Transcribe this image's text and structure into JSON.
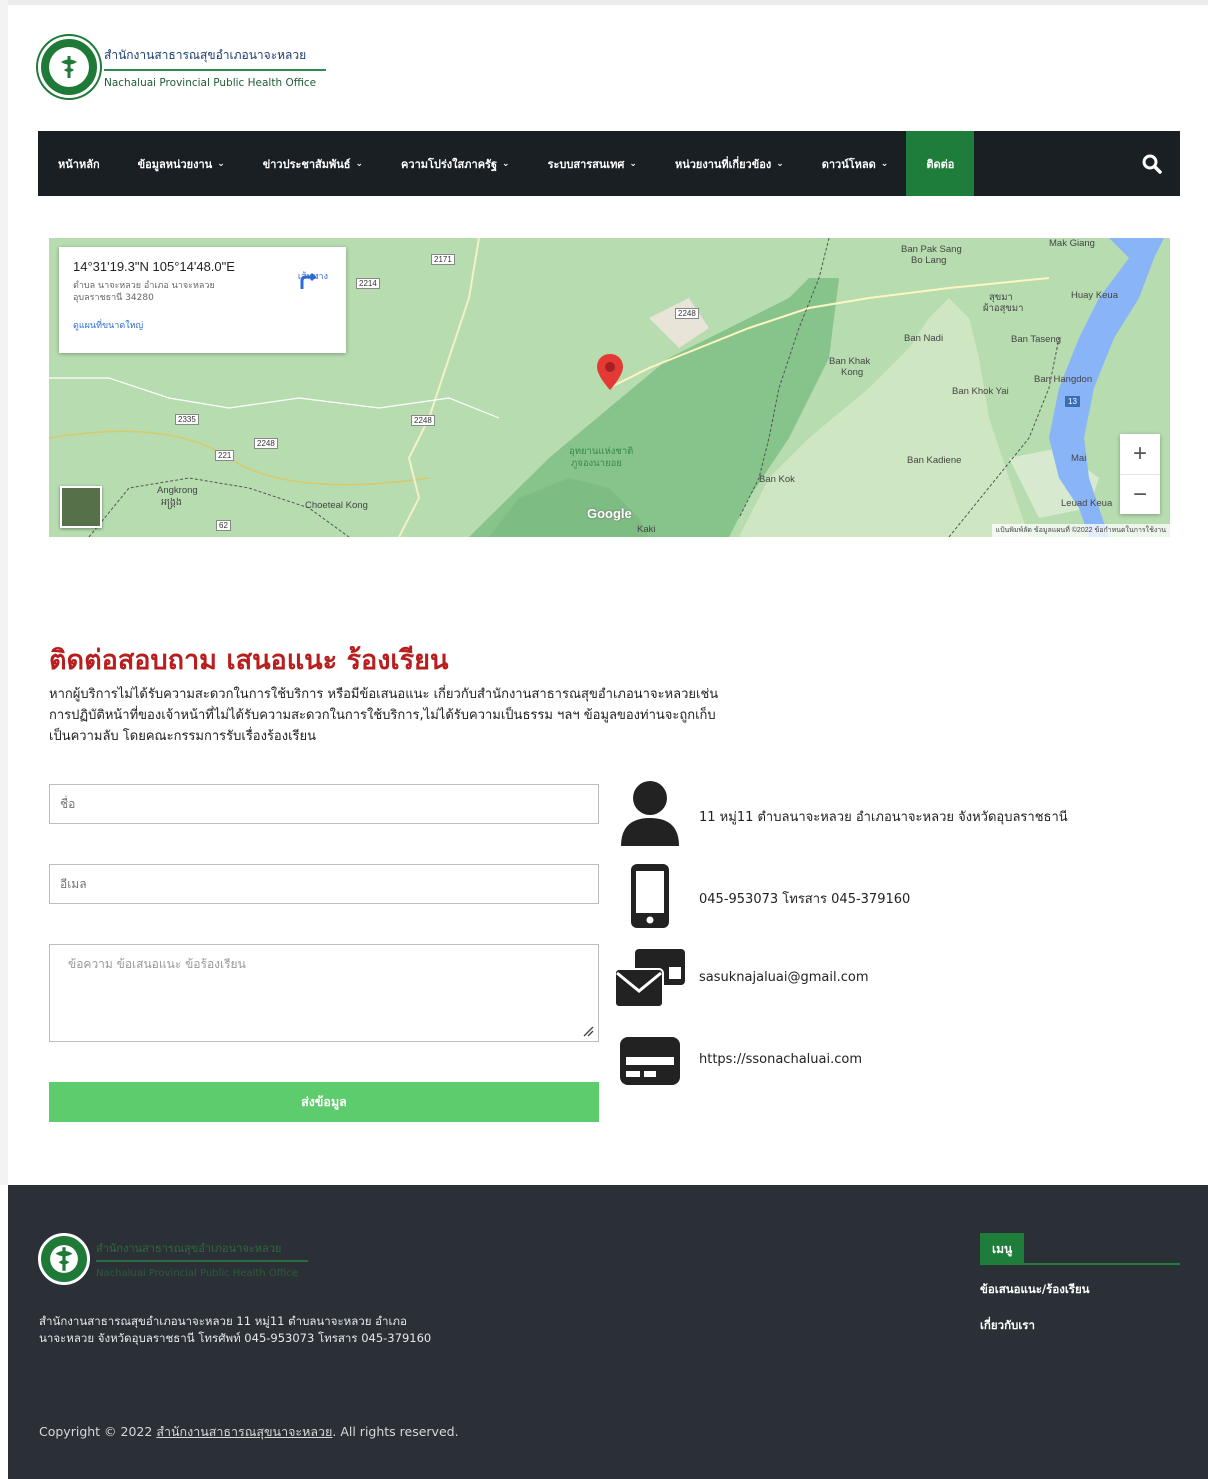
{
  "header": {
    "logo_th": "สำนักงานสาธารณสุขอำเภอนาจะหลวย",
    "logo_en": "Nachaluai Provincial Public Health Office"
  },
  "nav": {
    "items": [
      {
        "label": "หน้าหลัก"
      },
      {
        "label": "ข้อมูลหน่วยงาน"
      },
      {
        "label": "ข่าวประชาสัมพันธ์"
      },
      {
        "label": "ความโปร่งใสภาครัฐ"
      },
      {
        "label": "ระบบสารสนเทศ"
      },
      {
        "label": "หน่วยงานที่เกี่ยวข้อง"
      },
      {
        "label": "ดาวน์โหลด"
      },
      {
        "label": "ติดต่อ"
      }
    ]
  },
  "map": {
    "coords": "14°31'19.3\"N 105°14'48.0\"E",
    "address": "ตำบล นาจะหลวย อำเภอ นาจะหลวย อุบลราชธานี 34280",
    "directions_label": "เส้นทาง",
    "larger_map_link": "ดูแผนที่ขนาดใหญ่",
    "zoom_in": "+",
    "zoom_out": "−",
    "google_logo": "Google",
    "footer_text": "แป้นพิมพ์ลัด   ข้อมูลแผนที่ ©2022   ข้อกำหนดในการใช้งาน",
    "places": {
      "pak_sang": "Ban Pak Sang",
      "bo_lang": "Bo Lang",
      "mak_giang": "Mak Giang",
      "huay_keua": "Huay Keua",
      "sumuma": "สุขมา",
      "sumuma2": "ผ้าอสุขมา",
      "nadi": "Ban Nadi",
      "taseng": "Ban Taseng",
      "khak_kong": "Ban Khak",
      "khak_kong2": "Kong",
      "hangdon": "Ban Hangdon",
      "khok_yai": "Ban Khok Yai",
      "park": "อุทยานแห่งชาติ",
      "park2": "ภูจองนายอย",
      "kadiene": "Ban Kadiene",
      "mai": "Mai",
      "kok": "Ban Kok",
      "leuad": "Leuad Keua",
      "angkrong": "Angkrong",
      "angkrong_kh": "អង្គ្រង",
      "choeteal": "Choeteal Kong",
      "kaki": "Kaki"
    },
    "roads": {
      "r2171": "2171",
      "r2214": "2214",
      "r2248": "2248",
      "r2335": "2335",
      "r2248b": "2248",
      "r221": "221",
      "r2248c": "2248",
      "r62": "62",
      "r13": "13"
    }
  },
  "contact": {
    "title": "ติดต่อสอบถาม เสนอแนะ ร้องเรียน",
    "description": "หากผู้บริการไม่ได้รับความสะดวกในการใช้บริการ หรือมีข้อเสนอแนะ เกี่ยวกับสำนักงานสาธารณสุขอำเภอนาจะหลวยเช่น การปฏิบัติหน้าที่ของเจ้าหน้าที่ไม่ได้รับความสะดวกในการใช้บริการ,ไม่ได้รับความเป็นธรรม ฯลฯ ข้อมูลของท่านจะถูกเก็บเป็นความลับ โดยคณะกรรมการรับเรื่องร้องเรียน",
    "form": {
      "name_placeholder": "ชื่อ",
      "email_placeholder": "อีเมล",
      "message_placeholder": "ข้อความ ข้อเสนอแนะ ข้อร้องเรียน",
      "submit_label": "ส่งข้อมูล"
    },
    "info": {
      "address": "11 หมู่11 ตำบลนาจะหลวย อำเภอนาจะหลวย จังหวัดอุบลราชธานี",
      "phone": "045-953073 โทรสาร 045-379160",
      "email": "sasuknajaluai@gmail.com",
      "website": "https://ssonachaluai.com"
    }
  },
  "footer": {
    "logo_th": "สำนักงานสาธารณสุขอำเภอนาจะหลวย",
    "logo_en": "Nachaluai Provincial Public Health Office",
    "address_line1": "สำนักงานสาธารณสุขอำเภอนาจะหลวย 11 หมู่11 ตำบลนาจะหลวย อำเภอ",
    "address_line2": "นาจะหลวย จังหวัดอุบลราชธานี  โทรศัพท์ 045-953073 โทรสาร 045-379160",
    "menu_title": "เมนู",
    "menu_items": [
      "ข้อเสนอแนะ/ร้องเรียน",
      "เกี่ยวกับเรา"
    ],
    "copyright_prefix": "Copyright © 2022",
    "copyright_link": "สำนักงานสาธารณสุขนาจะหลวย",
    "copyright_suffix": ". All rights reserved."
  },
  "colors": {
    "nav_bg": "#1a1f24",
    "nav_active": "#1e7d3a",
    "title_red": "#b81e1e",
    "submit_green": "#5ccc6c",
    "footer_bg": "#2b3036"
  }
}
